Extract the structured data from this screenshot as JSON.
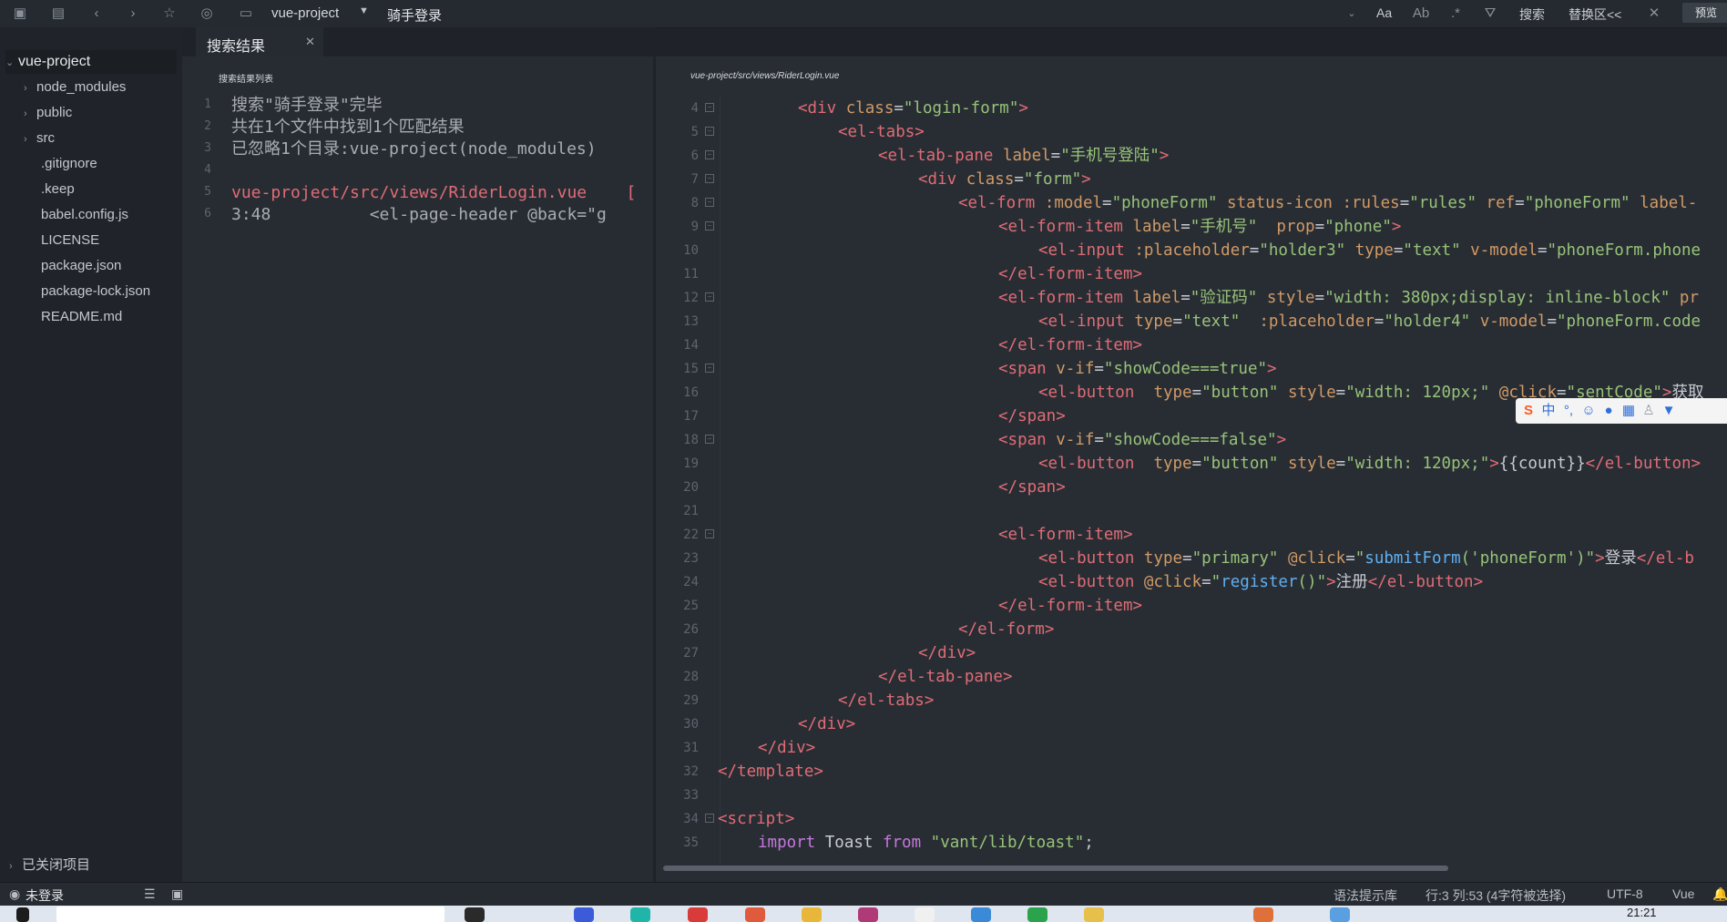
{
  "toolbar": {
    "project": "vue-project",
    "title": "骑手登录",
    "font_btn": "Aa",
    "search_label": "搜索",
    "replace_label": "替换区<<",
    "preview_label": "预览"
  },
  "sidebar": {
    "root": "vue-project",
    "items": [
      {
        "label": "node_modules",
        "folder": true
      },
      {
        "label": "public",
        "folder": true
      },
      {
        "label": "src",
        "folder": true
      },
      {
        "label": ".gitignore",
        "folder": false
      },
      {
        "label": ".keep",
        "folder": false
      },
      {
        "label": "babel.config.js",
        "folder": false
      },
      {
        "label": "LICENSE",
        "folder": false
      },
      {
        "label": "package.json",
        "folder": false
      },
      {
        "label": "package-lock.json",
        "folder": false
      },
      {
        "label": "README.md",
        "folder": false
      }
    ],
    "closed_projects": "已关闭项目"
  },
  "search_tab": {
    "label": "搜索结果",
    "list_title": "搜索结果列表",
    "lines": [
      {
        "n": "1",
        "text": "搜索\"骑手登录\"完毕"
      },
      {
        "n": "2",
        "text": "共在1个文件中找到1个匹配结果"
      },
      {
        "n": "3",
        "text": "已忽略1个目录:vue-project(node_modules)"
      },
      {
        "n": "4",
        "text": ""
      },
      {
        "n": "5",
        "text": "vue-project/src/views/RiderLogin.vue    ["
      },
      {
        "n": "6",
        "text": "3:48          <el-page-header @back=\"g"
      }
    ]
  },
  "editor": {
    "file_path": "vue-project/src/views/RiderLogin.vue",
    "lines": [
      {
        "n": "4",
        "fold": true
      },
      {
        "n": "5",
        "fold": true
      },
      {
        "n": "6",
        "fold": true
      },
      {
        "n": "7",
        "fold": true
      },
      {
        "n": "8",
        "fold": true
      },
      {
        "n": "9",
        "fold": true
      },
      {
        "n": "10",
        "fold": false
      },
      {
        "n": "11",
        "fold": false
      },
      {
        "n": "12",
        "fold": true
      },
      {
        "n": "13",
        "fold": false
      },
      {
        "n": "14",
        "fold": false
      },
      {
        "n": "15",
        "fold": true
      },
      {
        "n": "16",
        "fold": false
      },
      {
        "n": "17",
        "fold": false
      },
      {
        "n": "18",
        "fold": true
      },
      {
        "n": "19",
        "fold": false
      },
      {
        "n": "20",
        "fold": false
      },
      {
        "n": "21",
        "fold": false
      },
      {
        "n": "22",
        "fold": true
      },
      {
        "n": "23",
        "fold": false
      },
      {
        "n": "24",
        "fold": false
      },
      {
        "n": "25",
        "fold": false
      },
      {
        "n": "26",
        "fold": false
      },
      {
        "n": "27",
        "fold": false
      },
      {
        "n": "28",
        "fold": false
      },
      {
        "n": "29",
        "fold": false
      },
      {
        "n": "30",
        "fold": false
      },
      {
        "n": "31",
        "fold": false
      },
      {
        "n": "32",
        "fold": false
      },
      {
        "n": "33",
        "fold": false
      },
      {
        "n": "34",
        "fold": true
      },
      {
        "n": "35",
        "fold": false
      }
    ]
  },
  "status": {
    "user": "未登录",
    "syntax": "语法提示库",
    "position": "行:3  列:53 (4字符被选择)",
    "encoding": "UTF-8",
    "language": "Vue"
  },
  "taskbar": {
    "clock": "21:21"
  }
}
